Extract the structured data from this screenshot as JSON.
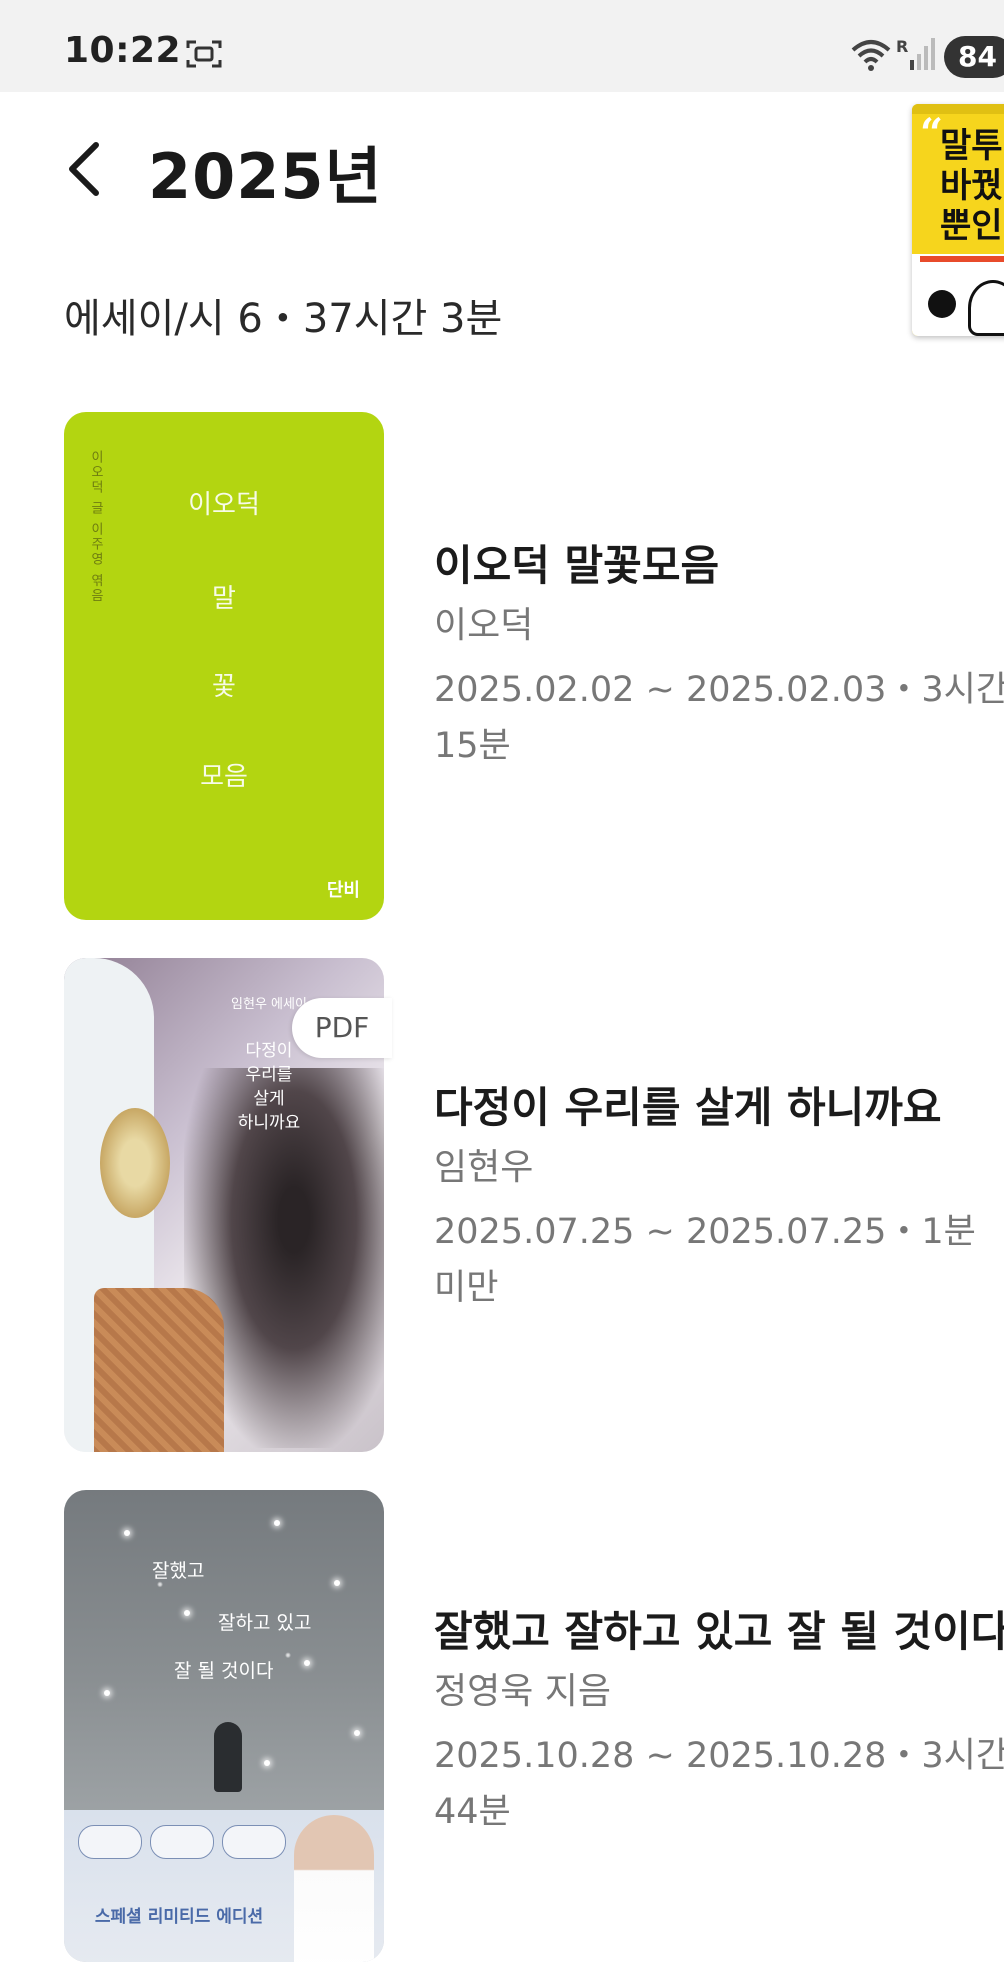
{
  "status_bar": {
    "time": "10:22",
    "battery": "84",
    "icons": [
      "screen-record-icon",
      "wifi-icon",
      "signal-icon",
      "battery-icon"
    ]
  },
  "header": {
    "back_icon": "back-arrow-icon",
    "title": "2025년"
  },
  "summary": "에세이/시 6・37시간 3분",
  "floating_book": {
    "title": "말투인\n바꿨\n뿐인"
  },
  "books": [
    {
      "title": "이오덕 말꽃모음",
      "author": "이오덕",
      "period": "2025.02.02 ~ 2025.02.03・3시간 15분",
      "cover": {
        "side": "이오덕 글 이주영 엮음",
        "lines": [
          "이오덕",
          "말",
          "꽃",
          "모음"
        ],
        "logo": "단비",
        "color": "#b3d511"
      }
    },
    {
      "title": "다정이 우리를 살게 하니까요",
      "author": "임현우",
      "period": "2025.07.25 ~ 2025.07.25・1분 미만",
      "badge": "PDF",
      "cover": {
        "top": "임현우 에세이",
        "lines": [
          "다정이",
          "우리를",
          "살게",
          "하니까요"
        ]
      }
    },
    {
      "title": "잘했고 잘하고 있고 잘 될 것이다",
      "author": "정영욱 지음",
      "period": "2025.10.28 ~ 2025.10.28・3시간 44분",
      "cover": {
        "lines": [
          "잘했고",
          "잘하고 있고",
          "잘 될 것이다"
        ],
        "banner": "스페셜 리미티드 에디션"
      }
    }
  ]
}
